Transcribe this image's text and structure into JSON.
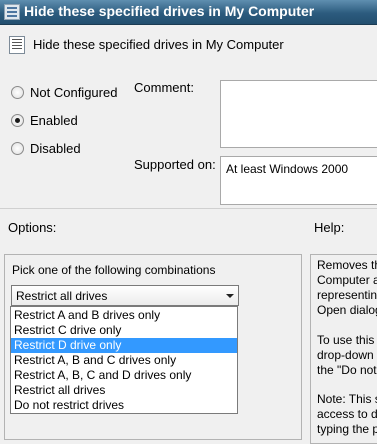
{
  "window": {
    "title": "Hide these specified drives in My Computer"
  },
  "header": {
    "setting_name": "Hide these specified drives in My Computer"
  },
  "state": {
    "options": [
      {
        "label": "Not Configured",
        "checked": false
      },
      {
        "label": "Enabled",
        "checked": true
      },
      {
        "label": "Disabled",
        "checked": false
      }
    ]
  },
  "comment": {
    "label": "Comment:",
    "value": ""
  },
  "supported": {
    "label": "Supported on:",
    "value": "At least Windows 2000"
  },
  "sections": {
    "options_label": "Options:",
    "help_label": "Help:"
  },
  "options_panel": {
    "prompt": "Pick one of the following combinations",
    "selected_value": "Restrict all drives",
    "dropdown_items": [
      "Restrict A and B drives only",
      "Restrict C drive only",
      "Restrict D drive only",
      "Restrict A, B and C drives only",
      "Restrict A, B, C and D drives only",
      "Restrict all drives",
      "Do not restrict drives"
    ],
    "highlighted_index": 2
  },
  "help": {
    "paragraphs": [
      [
        "Removes th",
        "Computer a",
        "representin",
        "Open dialog"
      ],
      [
        "To use this",
        "drop-down",
        "the \"Do not"
      ],
      [
        "Note: This s",
        "access to dr",
        "typing the p"
      ]
    ]
  }
}
